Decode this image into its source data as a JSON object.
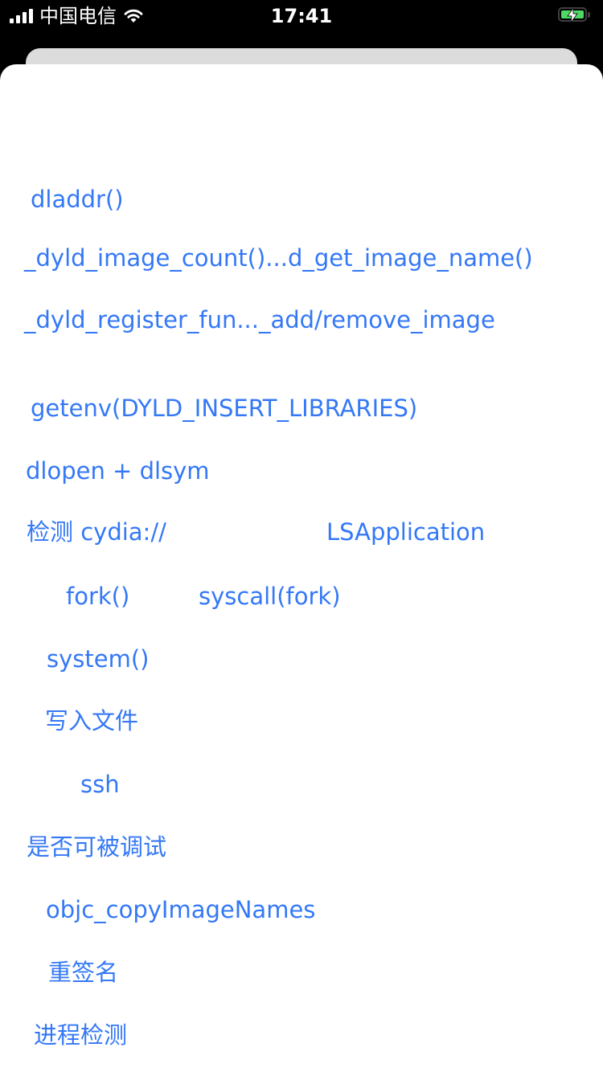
{
  "status_bar": {
    "carrier": "中国电信",
    "time": "17:41",
    "battery_fill_fraction": 1.0,
    "icons": [
      "signal-icon",
      "wifi-icon",
      "battery-charging-icon"
    ],
    "battery_color": "#4cd964"
  },
  "accent_color": "#3478f6",
  "buttons": {
    "dladdr": "dladdr()",
    "dyld_image_count": "_dyld_image_count()...d_get_image_name()",
    "dyld_register": "_dyld_register_fun..._add/remove_image",
    "getenv": "getenv(DYLD_INSERT_LIBRARIES)",
    "dlopen": "dlopen + dlsym",
    "cydia": "检测 cydia://",
    "lsapplication": "LSApplication",
    "fork": "fork()",
    "syscall_fork": "syscall(fork)",
    "system": "system()",
    "write_file": "写入文件",
    "ssh": "ssh",
    "debuggable": "是否可被调试",
    "objc_copy": "objc_copyImageNames",
    "resign": "重签名",
    "process_detect": "进程检测"
  }
}
